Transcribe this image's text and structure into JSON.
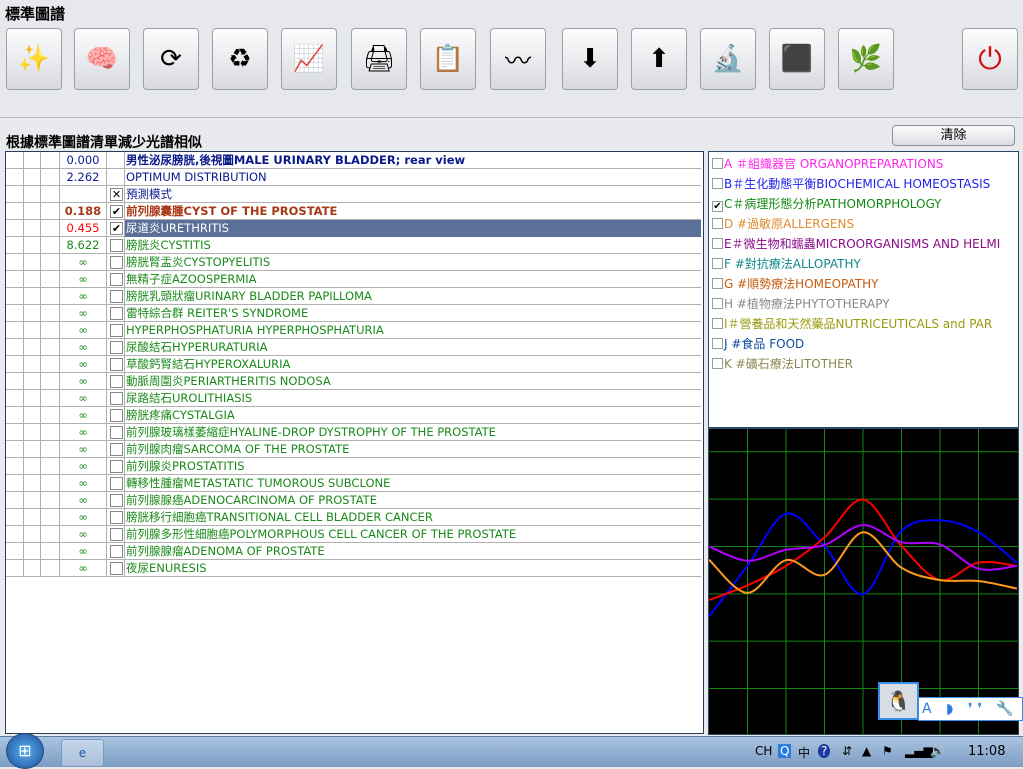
{
  "window_title": "標準圖譜",
  "toolbar": {
    "buttons": [
      {
        "icon": "magic-wand-icon",
        "glyph": "✨"
      },
      {
        "icon": "brain-scan-icon",
        "glyph": "🧠"
      },
      {
        "icon": "cycle-arrows-icon",
        "glyph": "⟳"
      },
      {
        "icon": "triangle-arrows-icon",
        "glyph": "♻"
      },
      {
        "icon": "chart-up-arrows-icon",
        "glyph": "📈"
      },
      {
        "icon": "printer-icon",
        "glyph": "🖨"
      },
      {
        "icon": "clipboard-icon",
        "glyph": "📋"
      },
      {
        "icon": "spectrum-graph-icon",
        "glyph": "〰"
      },
      {
        "icon": "container-in-icon",
        "glyph": "⬇"
      },
      {
        "icon": "container-out-icon",
        "glyph": "⬆"
      },
      {
        "icon": "microscope-gear-icon",
        "glyph": "🔬"
      },
      {
        "icon": "black-stone-icon",
        "glyph": "⬛"
      },
      {
        "icon": "herb-plant-icon",
        "glyph": "🌿"
      },
      {
        "icon": "power-icon",
        "glyph": "⏻"
      }
    ]
  },
  "subtitle": "根據標準圖譜清單減少光譜相似",
  "clear_label": "清除",
  "colors": {
    "navy": "#0a1a8a",
    "brown": "#a83a18",
    "red": "#ff0000",
    "green": "#1a8a1a",
    "selected_bg": "#5a7099"
  },
  "rows": [
    {
      "value": "0.000",
      "text": "男性泌尿膀胱,後視圖MALE URINARY BLADDER; rear view",
      "check": "",
      "style": "header"
    },
    {
      "value": "2.262",
      "text": "OPTIMUM DISTRIBUTION",
      "check": "",
      "style": "navy"
    },
    {
      "value": "",
      "text": "預測模式",
      "check": "✕",
      "style": "navy"
    },
    {
      "value": "0.188",
      "text": "前列腺囊腫CYST  OF THE  PROSTATE",
      "check": "✔",
      "style": "brown"
    },
    {
      "value": "0.455",
      "text": "尿道炎URETHRITIS",
      "check": "✔",
      "style": "selected"
    },
    {
      "value": "8.622",
      "text": "膀胱炎CYSTITIS",
      "check": "",
      "style": "green"
    },
    {
      "value": "∞",
      "text": "膀胱腎盂炎CYSTOPYELITIS",
      "check": "",
      "style": "green"
    },
    {
      "value": "∞",
      "text": "無精子症AZOOSPERMIA",
      "check": "",
      "style": "green"
    },
    {
      "value": "∞",
      "text": "膀胱乳頭狀瘤URINARY BLADDER PAPILLOMA",
      "check": "",
      "style": "green"
    },
    {
      "value": "∞",
      "text": "雷特綜合群 REITER'S  SYNDROME",
      "check": "",
      "style": "green"
    },
    {
      "value": "∞",
      "text": "HYPERPHOSPHATURIA HYPERPHOSPHATURIA",
      "check": "",
      "style": "green"
    },
    {
      "value": "∞",
      "text": "尿酸結石HYPERURATURIA",
      "check": "",
      "style": "green"
    },
    {
      "value": "∞",
      "text": "草酸鈣腎結石HYPEROXALURIA",
      "check": "",
      "style": "green"
    },
    {
      "value": "∞",
      "text": "動脈周圍炎PERIARTHERITIS  NODOSA",
      "check": "",
      "style": "green"
    },
    {
      "value": "∞",
      "text": "尿路結石UROLITHIASIS",
      "check": "",
      "style": "green"
    },
    {
      "value": "∞",
      "text": "膀胱疼痛CYSTALGIA",
      "check": "",
      "style": "green"
    },
    {
      "value": "∞",
      "text": "前列腺玻璃樣萎縮症HYALINE-DROP  DYSTROPHY OF  THE  PROSTATE",
      "check": "",
      "style": "green"
    },
    {
      "value": "∞",
      "text": "前列腺肉瘤SARCOMA  OF THE PROSTATE",
      "check": "",
      "style": "green"
    },
    {
      "value": "∞",
      "text": "前列腺炎PROSTATITIS",
      "check": "",
      "style": "green"
    },
    {
      "value": "∞",
      "text": "轉移性腫瘤METASTATIC TUMOROUS SUBCLONE",
      "check": "",
      "style": "green"
    },
    {
      "value": "∞",
      "text": "前列腺腺癌ADENOCARCINOMA  OF PROSTATE",
      "check": "",
      "style": "green"
    },
    {
      "value": "∞",
      "text": "膀胱移行細胞癌TRANSITIONAL  CELL  BLADDER  CANCER",
      "check": "",
      "style": "green"
    },
    {
      "value": "∞",
      "text": "前列腺多形性細胞癌POLYMORPHOUS  CELL  CANCER  OF  THE  PROSTATE",
      "check": "",
      "style": "green"
    },
    {
      "value": "∞",
      "text": "前列腺腺瘤ADENOMA  OF PROSTATE",
      "check": "",
      "style": "green"
    },
    {
      "value": "∞",
      "text": "夜尿ENURESIS",
      "check": "",
      "style": "green"
    }
  ],
  "categories": [
    {
      "label": "A ＃組織器官 ORGANOPREPARATIONS",
      "color": "#ff22ee",
      "checked": false
    },
    {
      "label": "B＃生化動態平衡BIOCHEMICAL HOMEOSTASIS",
      "color": "#2222ee",
      "checked": false
    },
    {
      "label": "C＃病理形態分析PATHOMORPHOLOGY",
      "color": "#108a10",
      "checked": true
    },
    {
      "label": "D #過敏原ALLERGENS",
      "color": "#e08a30",
      "checked": false
    },
    {
      "label": "E＃微生物和蠕蟲MICROORGANISMS AND HELMI",
      "color": "#8a0a8a",
      "checked": false
    },
    {
      "label": "F #對抗療法ALLOPATHY",
      "color": "#108a8a",
      "checked": false
    },
    {
      "label": "G #順勢療法HOMEOPATHY",
      "color": "#c85a10",
      "checked": false
    },
    {
      "label": "H #植物療法PHYTOTHERAPY",
      "color": "#8a8a8a",
      "checked": false
    },
    {
      "label": "I＃營養品和天然藥品NUTRICEUTICALS and PAR",
      "color": "#9a9a10",
      "checked": false
    },
    {
      "label": "J #食品 FOOD",
      "color": "#104aa0",
      "checked": false
    },
    {
      "label": "K #礦石療法LITOTHER",
      "color": "#8a8a50",
      "checked": false
    }
  ],
  "chart_data": {
    "type": "line",
    "grid": true,
    "background": "#000000",
    "grid_color": "#108a10",
    "x": [
      0,
      1,
      2,
      3,
      4,
      5,
      6,
      7,
      8
    ],
    "ylim": [
      -0.96,
      5.48
    ],
    "series": [
      {
        "color": "#0000ff",
        "values": [
          1.52,
          2.59,
          3.69,
          3.01,
          1.99,
          3.33,
          3.55,
          3.3,
          2.65
        ]
      },
      {
        "color": "#ff0000",
        "values": [
          1.87,
          2.18,
          2.59,
          3.19,
          3.99,
          3.01,
          2.29,
          2.66,
          2.59
        ]
      },
      {
        "color": "#b000ff",
        "values": [
          3.0,
          2.7,
          2.93,
          3.03,
          3.45,
          3.09,
          3.04,
          2.53,
          2.59
        ]
      },
      {
        "color": "#ff9a20",
        "values": [
          2.72,
          2.02,
          2.71,
          2.4,
          3.3,
          2.55,
          2.29,
          2.27,
          2.11
        ]
      }
    ]
  },
  "ime_bar": {
    "letters": "A ◗ ❜❜ 🔧 📋"
  },
  "taskbar": {
    "app": "e",
    "lang": "CH",
    "ime": "中",
    "clock": "11:08"
  }
}
